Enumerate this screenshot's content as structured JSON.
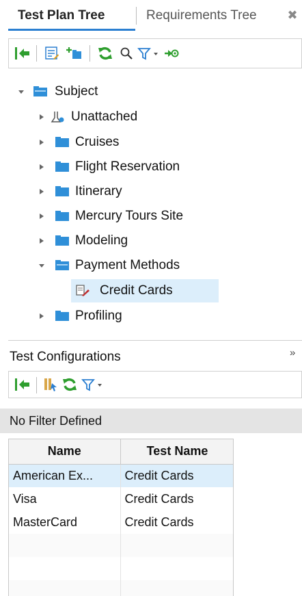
{
  "tabs": [
    {
      "label": "Test Plan Tree",
      "active": true
    },
    {
      "label": "Requirements Tree",
      "active": false
    }
  ],
  "toolbar_icons": [
    "back-arrow-icon",
    "details-icon",
    "new-folder-icon",
    "refresh-icon",
    "find-icon",
    "filter-icon",
    "dropdown-arrow-icon",
    "go-to-icon"
  ],
  "tree": {
    "root": "Subject",
    "items": [
      {
        "label": "Unattached",
        "type": "special"
      },
      {
        "label": "Cruises",
        "type": "folder"
      },
      {
        "label": "Flight Reservation",
        "type": "folder"
      },
      {
        "label": "Itinerary",
        "type": "folder"
      },
      {
        "label": "Mercury Tours Site",
        "type": "folder"
      },
      {
        "label": "Modeling",
        "type": "folder"
      },
      {
        "label": "Payment Methods",
        "type": "folder-open"
      },
      {
        "label": "Credit Cards",
        "type": "test",
        "selected": true
      },
      {
        "label": "Profiling",
        "type": "folder"
      }
    ]
  },
  "configurations": {
    "title": "Test Configurations",
    "filter_text": "No Filter Defined",
    "columns": [
      "Name",
      "Test Name"
    ],
    "rows": [
      {
        "name": "American Ex...",
        "test_name": "Credit Cards",
        "selected": true
      },
      {
        "name": "Visa",
        "test_name": "Credit Cards"
      },
      {
        "name": "MasterCard",
        "test_name": "Credit Cards"
      }
    ]
  },
  "colors": {
    "accent": "#2b7fd1",
    "selection": "#dceefb",
    "folder": "#2f8fd8",
    "refresh": "#2e9e2e"
  }
}
